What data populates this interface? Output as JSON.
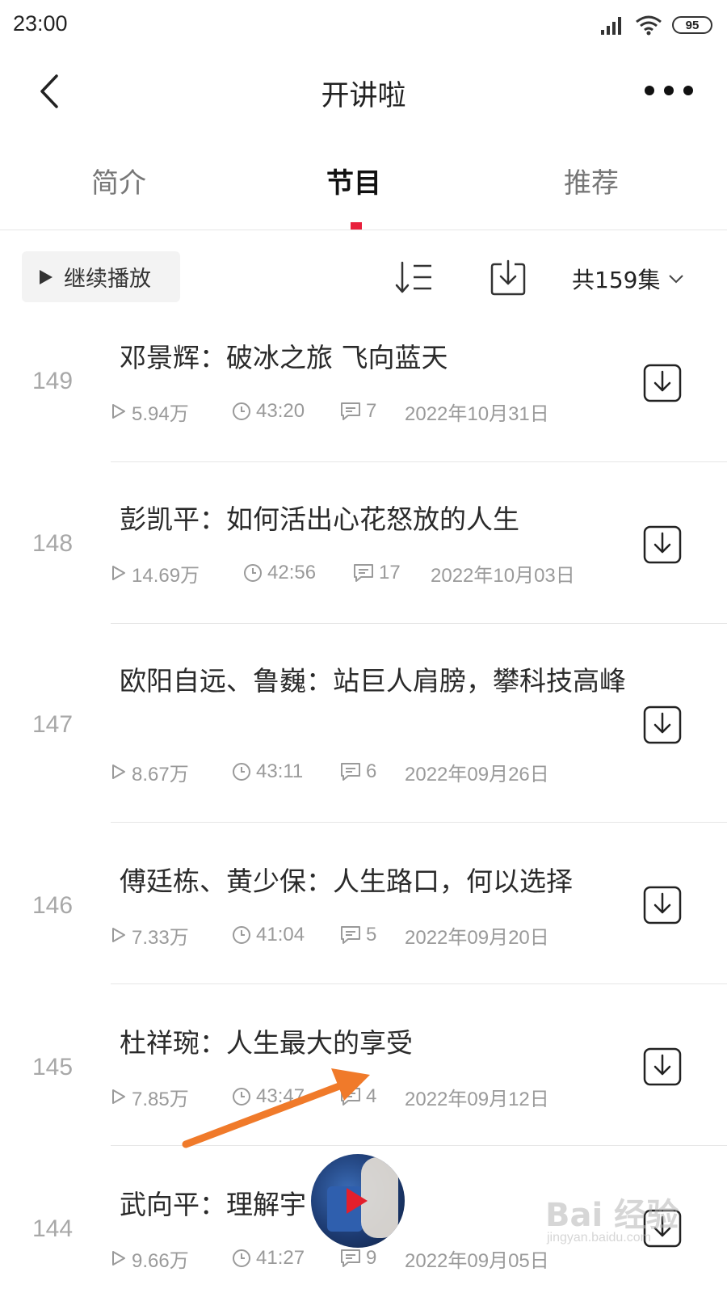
{
  "status_bar": {
    "time": "23:00",
    "battery": "95"
  },
  "nav": {
    "title": "开讲啦"
  },
  "tabs": [
    {
      "label": "简介"
    },
    {
      "label": "节目",
      "active": true
    },
    {
      "label": "推荐"
    }
  ],
  "toolbar": {
    "continue_label": "继续播放",
    "episode_count": "共159集"
  },
  "episodes": [
    {
      "num": "149",
      "title": "邓景辉：破冰之旅 飞向蓝天",
      "plays": "5.94万",
      "duration": "43:20",
      "comments": "7",
      "date": "2022年10月31日"
    },
    {
      "num": "148",
      "title": "彭凯平：如何活出心花怒放的人生",
      "plays": "14.69万",
      "duration": "42:56",
      "comments": "17",
      "date": "2022年10月03日"
    },
    {
      "num": "147",
      "title": "欧阳自远、鲁巍：站巨人肩膀，攀科技高峰",
      "plays": "8.67万",
      "duration": "43:11",
      "comments": "6",
      "date": "2022年09月26日"
    },
    {
      "num": "146",
      "title": "傅廷栋、黄少保：人生路口，何以选择",
      "plays": "7.33万",
      "duration": "41:04",
      "comments": "5",
      "date": "2022年09月20日"
    },
    {
      "num": "145",
      "title": "杜祥琬：人生最大的享受",
      "plays": "7.85万",
      "duration": "43:47",
      "comments": "4",
      "date": "2022年09月12日"
    },
    {
      "num": "144",
      "title": "武向平：理解宇",
      "plays": "9.66万",
      "duration": "41:27",
      "comments": "9",
      "date": "2022年09月05日"
    }
  ],
  "watermark": {
    "brand": "Bai 经验",
    "site": "jingyan.baidu.com"
  },
  "colors": {
    "accent": "#e8203c",
    "annotation_arrow": "#f07a2a"
  }
}
